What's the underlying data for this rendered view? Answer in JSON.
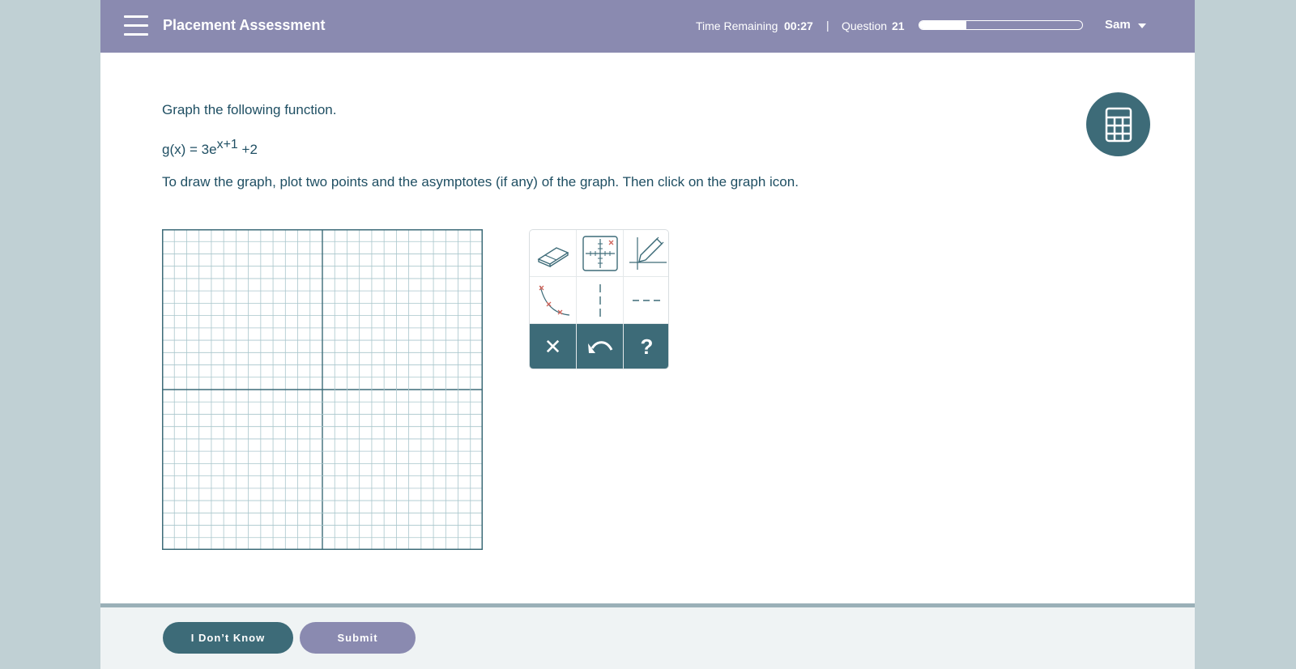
{
  "header": {
    "title": "Placement Assessment",
    "time_label": "Time Remaining",
    "time_value": "00:27",
    "separator": "|",
    "question_label": "Question",
    "question_number": "21",
    "progress_fraction": 0.29,
    "user_name": "Sam"
  },
  "question": {
    "prompt": "Graph the following function.",
    "equation_base": "g(x) = 3e",
    "equation_exponent": "x+1",
    "equation_tail": " +2",
    "instructions": "To draw the graph, plot two points and the asymptotes (if any) of the graph.  Then click on the graph icon."
  },
  "tools": {
    "icons": [
      "eraser-icon",
      "point-plot-icon",
      "graph-draw-icon",
      "exponential-curve-icon",
      "vertical-asymptote-icon",
      "horizontal-asymptote-icon",
      "close-icon",
      "undo-icon",
      "help-icon"
    ],
    "clear_glyph": "✕",
    "help_glyph": "?"
  },
  "footer": {
    "dont_know_label": "I Don’t Know",
    "submit_label": "Submit"
  },
  "colors": {
    "header": "#8a8ab0",
    "accent": "#3d6b78",
    "text": "#1f4f63",
    "grid_line": "#a9c6cc",
    "marker": "#d0645a"
  }
}
